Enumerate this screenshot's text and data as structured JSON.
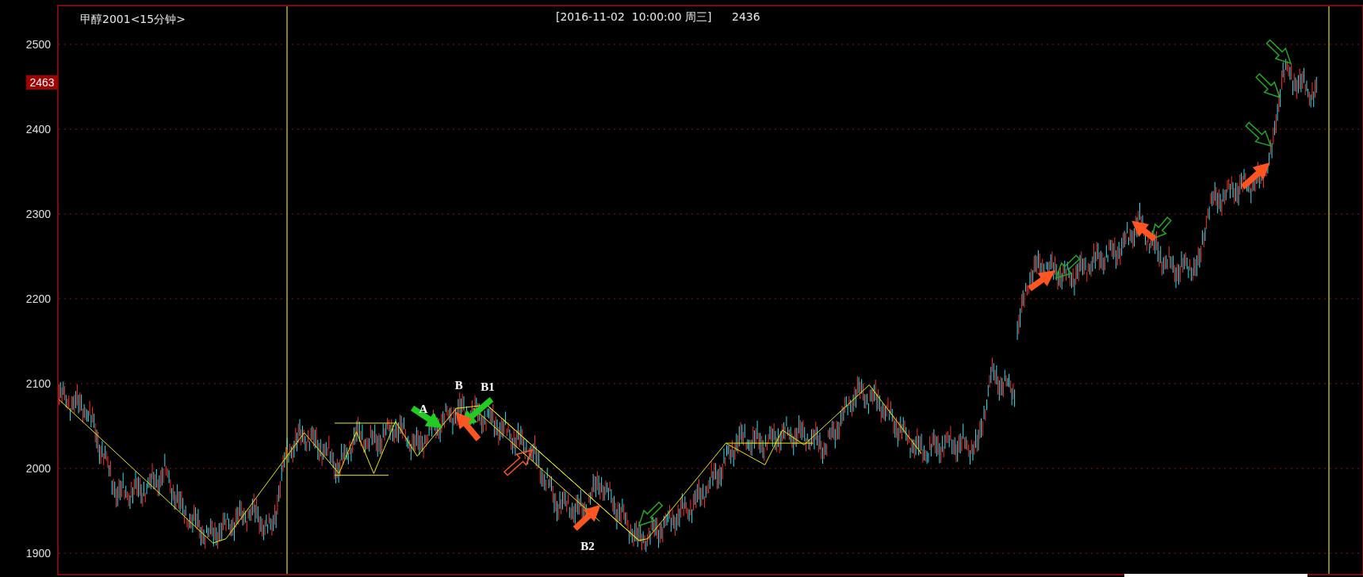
{
  "chart": {
    "title": "甲醇2001<15分钟>",
    "cursor_info": "[2016-11-02  10:00:00 周三]",
    "cursor_value": "2436",
    "current_price": "2463",
    "price_labels": [
      "2500",
      "2400",
      "2300",
      "2200",
      "2100",
      "2000",
      "1900"
    ],
    "annotations": [
      {
        "text": "A"
      },
      {
        "text": "B"
      },
      {
        "text": "B1"
      },
      {
        "text": "B2"
      }
    ]
  }
}
